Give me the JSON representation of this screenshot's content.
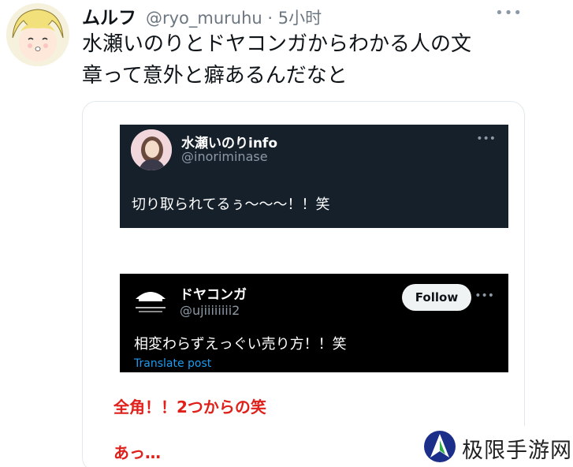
{
  "tweet": {
    "display_name": "ムルフ",
    "handle_and_time": "@ryo_muruhu · 5小时",
    "more": "•••",
    "text_line1": "水瀬いのりとドヤコンガからわかる人の文",
    "text_line2": "章って意外と癖あるんだなと"
  },
  "embed1": {
    "name": "水瀬いのりinfo",
    "handle": "@inoriminase",
    "more": "•••",
    "text": "切り取られてるぅ〜〜〜！！笑"
  },
  "embed2": {
    "name": "ドヤコンガ",
    "handle": "@ujiiiiiiii2",
    "follow_label": "Follow",
    "more": "•••",
    "text": "相変わらずえっぐい売り方！！笑",
    "translate": "Translate post"
  },
  "annotations": {
    "line1": "全角！！2つからの笑",
    "line2": "あっ…"
  },
  "watermark": {
    "text": "极限手游网"
  },
  "colors": {
    "annotation_red": "#e0201a",
    "dark_bg_1": "#15202b",
    "dark_bg_2": "#000000",
    "link_blue": "#1d9bf0"
  }
}
